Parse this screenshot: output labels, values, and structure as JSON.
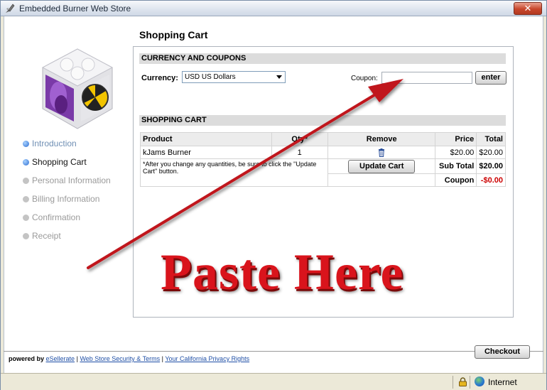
{
  "window": {
    "title": "Embedded Burner Web Store",
    "close_glyph": "✕"
  },
  "page": {
    "title": "Shopping Cart"
  },
  "steps": [
    {
      "label": "Introduction"
    },
    {
      "label": "Shopping Cart"
    },
    {
      "label": "Personal Information"
    },
    {
      "label": "Billing Information"
    },
    {
      "label": "Confirmation"
    },
    {
      "label": "Receipt"
    }
  ],
  "currency_section": {
    "heading": "CURRENCY AND COUPONS",
    "currency_label": "Currency:",
    "currency_value": "USD US Dollars",
    "coupon_label": "Coupon:",
    "coupon_value": "",
    "enter_label": "enter"
  },
  "cart": {
    "heading": "SHOPPING CART",
    "columns": {
      "product": "Product",
      "qty": "Qty*",
      "remove": "Remove",
      "price": "Price",
      "total": "Total"
    },
    "items": [
      {
        "product": "kJams Burner",
        "qty": "1",
        "price": "$20.00",
        "total": "$20.00"
      }
    ],
    "note": "*After you change any quantities, be sure to click the \"Update Cart\" button.",
    "update_label": "Update Cart",
    "subtotal_label": "Sub Total",
    "subtotal_value": "$20.00",
    "coupon_label": "Coupon",
    "coupon_value": "-$0.00"
  },
  "footer": {
    "powered_prefix": "powered by",
    "powered_brand": "eSellerate",
    "link_security": "Web Store Security & Terms",
    "link_privacy": "Your California Privacy Rights",
    "separator": "|",
    "checkout_label": "Checkout"
  },
  "statusbar": {
    "zone": "Internet"
  },
  "annotation": {
    "text": "Paste Here",
    "color": "#d9141c"
  },
  "colors": {
    "accent_link": "#1f4fa6",
    "negative": "#cc0000",
    "arrow": "#c0121a"
  },
  "icons": [
    "app-icon",
    "close-icon",
    "dropdown-arrow-icon",
    "trash-icon",
    "lock-icon",
    "globe-icon",
    "arrow-annotation"
  ]
}
